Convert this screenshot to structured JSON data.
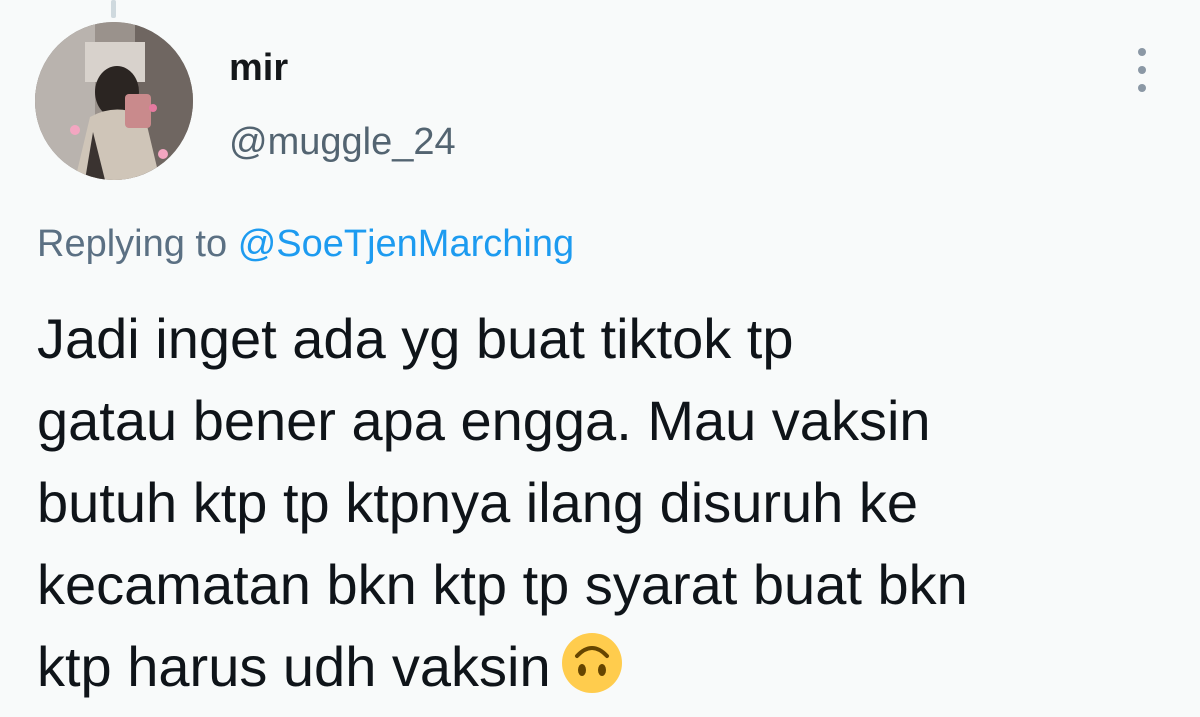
{
  "tweet": {
    "display_name": "mir",
    "handle": "@muggle_24",
    "reply_prefix": "Replying to",
    "reply_to": "@SoeTjenMarching",
    "text": "Jadi inget ada yg buat tiktok tp\ngatau bener apa engga. Mau vaksin\nbutuh ktp tp ktpnya ilang disuruh ke\nkecamatan bkn ktp tp syarat buat bkn\nktp harus udh vaksin",
    "emoji": "upside-down-face-emoji"
  },
  "icons": {
    "more": "more-vertical-icon"
  },
  "colors": {
    "background": "#f8fafa",
    "text": "#0f1419",
    "secondary": "#5b7083",
    "link": "#1d9bf0",
    "emoji": "#ffcc4d"
  }
}
